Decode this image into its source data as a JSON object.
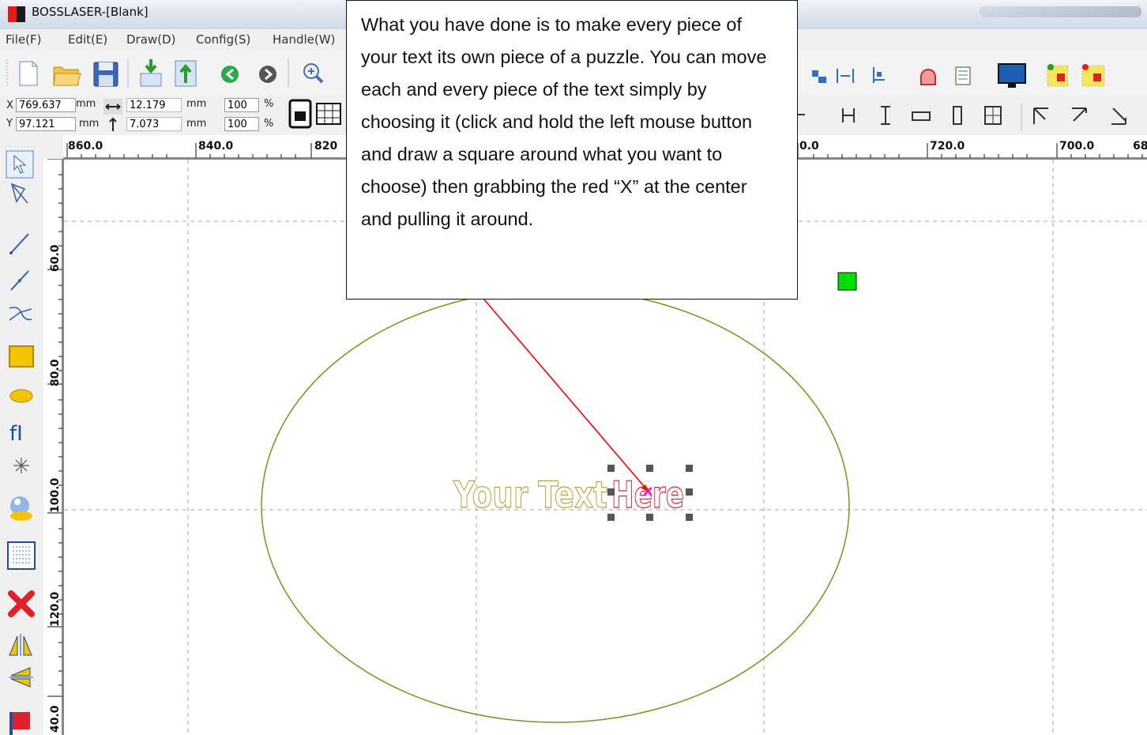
{
  "window": {
    "title": "BOSSLASER-[Blank]"
  },
  "menu": [
    "File(F)",
    "Edit(E)",
    "Draw(D)",
    "Config(S)",
    "Handle(W)"
  ],
  "coords": {
    "x_label": "X",
    "x_value": "769.637",
    "x_unit": "mm",
    "y_label": "Y",
    "y_value": "97.121",
    "y_unit": "mm",
    "width_value": "12.179",
    "width_unit": "mm",
    "height_value": "7.073",
    "height_unit": "mm",
    "scale_x": "100",
    "scale_y": "100",
    "scale_unit": "%"
  },
  "ruler_h": [
    "860.0",
    "840.0",
    "820",
    "0.0",
    "720.0",
    "700.0",
    "68"
  ],
  "ruler_v": [
    "60.0",
    "80.0",
    "100.0",
    "120.0",
    "40.0"
  ],
  "canvas": {
    "text_object": "Your Text Here",
    "selected_part": "Here"
  },
  "callout": {
    "text": "What you have done is to make every piece of your text its own piece of a puzzle.  You can move each and every piece of the text simply by choosing it (click and hold the left mouse button and draw a square around what you want to choose)   then grabbing the red “X” at the center and pulling it around."
  },
  "colors": {
    "ellipse": "#8a8a1e",
    "text_outline": "#b5a33c",
    "selected": "#e0202a",
    "arrow": "#ff0000",
    "marker": "#00dd00"
  },
  "icons": {
    "toolbar1": [
      "new-file-icon",
      "open-folder-icon",
      "save-icon",
      "import-icon",
      "export-icon",
      "back-icon",
      "forward-icon",
      "zoom-in-icon",
      "layout-icon",
      "align-icon",
      "align-right-icon",
      "shape-icon",
      "list-icon",
      "monitor-icon",
      "layer-icon",
      "layer2-icon"
    ],
    "left": [
      "select-icon",
      "node-edit-icon",
      "line-icon",
      "polyline-icon",
      "bezier-icon",
      "rectangle-icon",
      "ellipse-icon",
      "text-icon",
      "point-icon",
      "bitmap-icon",
      "array-icon",
      "delete-icon",
      "mirror-h-icon",
      "mirror-v-icon",
      "flag-icon"
    ]
  }
}
